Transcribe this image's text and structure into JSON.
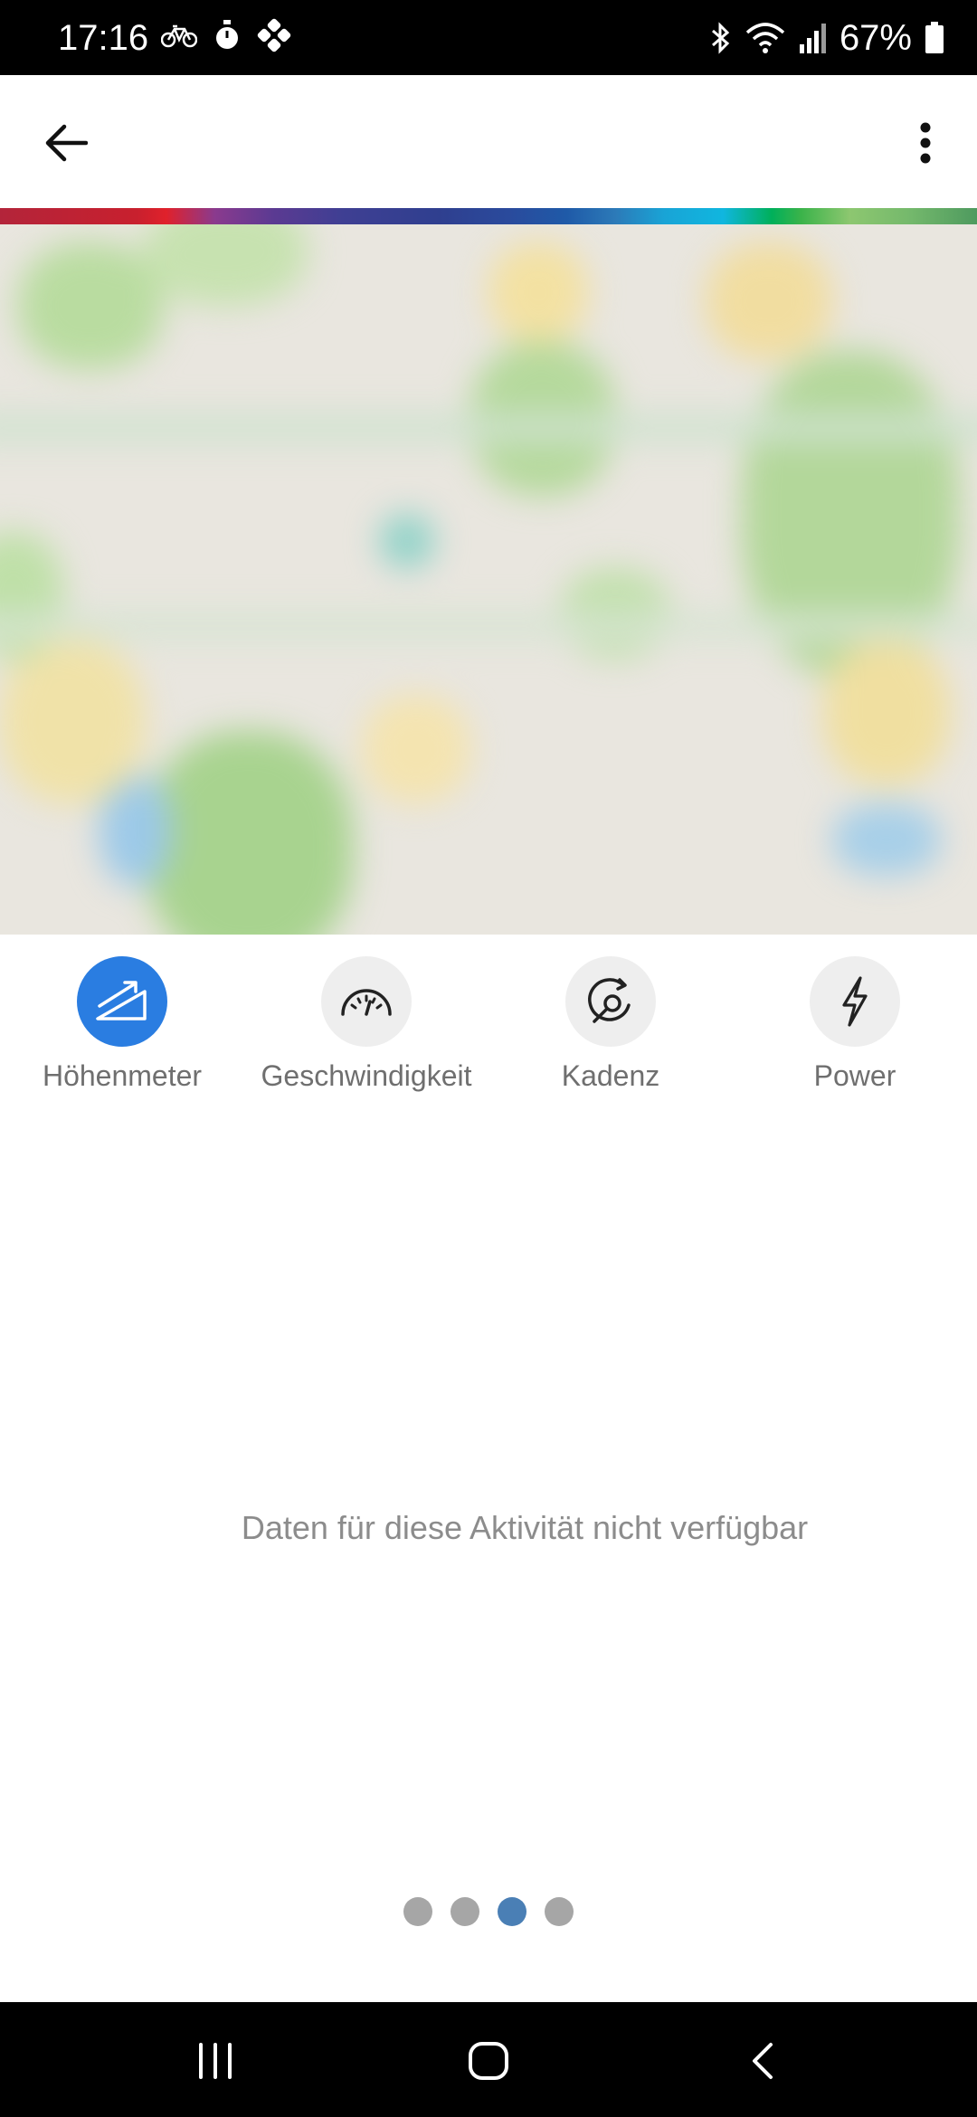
{
  "status_bar": {
    "time": "17:16",
    "battery": "67%",
    "left_icons": [
      "bike-icon",
      "stopwatch-icon",
      "app-icon"
    ],
    "right_icons": [
      "bluetooth-icon",
      "wifi-icon",
      "signal-icon",
      "battery-icon"
    ]
  },
  "app_bar": {
    "back_icon": "arrow-left-icon",
    "menu_icon": "more-vertical-icon"
  },
  "metrics": [
    {
      "label": "Höhenmeter",
      "icon": "elevation-icon",
      "active": true
    },
    {
      "label": "Geschwindigkeit",
      "icon": "speedometer-icon",
      "active": false
    },
    {
      "label": "Kadenz",
      "icon": "cadence-icon",
      "active": false
    },
    {
      "label": "Power",
      "icon": "lightning-icon",
      "active": false
    }
  ],
  "empty_message": "Daten für diese Aktivität nicht verfügbar",
  "pager": {
    "count": 4,
    "active_index": 2
  },
  "colors": {
    "accent": "#2a7de1",
    "pager_active": "#4a7fb5",
    "pager_inactive": "#a6a6a6"
  }
}
